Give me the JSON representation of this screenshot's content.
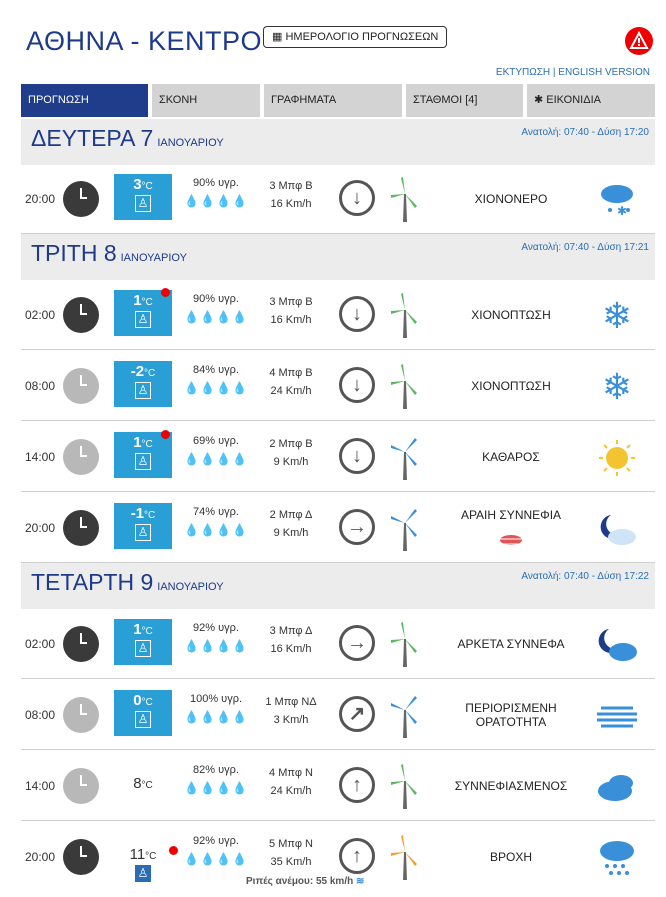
{
  "header": {
    "city": "ΑΘΗΝΑ - ΚΕΝΤΡΟ",
    "calendar_button": "ΗΜΕΡΟΛΟΓΙΟ ΠΡΟΓΝΩΣΕΩΝ",
    "print_link": "ΕΚΤΥΠΩΣΗ",
    "english_link": "ENGLISH VERSION"
  },
  "tabs": [
    {
      "label": "ΠΡΟΓΝΩΣΗ"
    },
    {
      "label": "ΣΚΟΝΗ"
    },
    {
      "label": "ΓΡΑΦΗΜΑΤΑ"
    },
    {
      "label": "ΣΤΑΘΜΟΙ [4]"
    },
    {
      "label": "ΕΙΚΟΝΙΔΙΑ"
    }
  ],
  "days": [
    {
      "name": "ΔΕΥΤΕΡΑ 7",
      "month": "ΙΑΝΟΥΑΡΙΟΥ",
      "sun": "Ανατολή: 07:40 - Δύση 17:20"
    },
    {
      "name": "ΤΡΙΤΗ 8",
      "month": "ΙΑΝΟΥΑΡΙΟΥ",
      "sun": "Ανατολή: 07:40 - Δύση 17:21"
    },
    {
      "name": "ΤΕΤΑΡΤΗ 9",
      "month": "ΙΑΝΟΥΑΡΙΟΥ",
      "sun": "Ανατολή: 07:40 - Δύση 17:22"
    }
  ],
  "rows": [
    {
      "time": "20:00",
      "temp": "3",
      "hum": "90% υγρ.",
      "wind1": "3 Μπφ Β",
      "wind2": "16 Km/h",
      "cond": "ΧΙΟΝΟΝΕΡΟ"
    },
    {
      "time": "02:00",
      "temp": "1",
      "hum": "90% υγρ.",
      "wind1": "3 Μπφ Β",
      "wind2": "16 Km/h",
      "cond": "ΧΙΟΝΟΠΤΩΣΗ"
    },
    {
      "time": "08:00",
      "temp": "-2",
      "hum": "84% υγρ.",
      "wind1": "4 Μπφ Β",
      "wind2": "24 Km/h",
      "cond": "ΧΙΟΝΟΠΤΩΣΗ"
    },
    {
      "time": "14:00",
      "temp": "1",
      "hum": "69% υγρ.",
      "wind1": "2 Μπφ Β",
      "wind2": "9 Km/h",
      "cond": "ΚΑΘΑΡΟΣ"
    },
    {
      "time": "20:00",
      "temp": "-1",
      "hum": "74% υγρ.",
      "wind1": "2 Μπφ Δ",
      "wind2": "9 Km/h",
      "cond": "ΑΡΑΙΗ ΣΥΝΝΕΦΙΑ"
    },
    {
      "time": "02:00",
      "temp": "1",
      "hum": "92% υγρ.",
      "wind1": "3 Μπφ Δ",
      "wind2": "16 Km/h",
      "cond": "ΑΡΚΕΤΑ ΣΥΝΝΕΦΑ"
    },
    {
      "time": "08:00",
      "temp": "0",
      "hum": "100% υγρ.",
      "wind1": "1 Μπφ ΝΔ",
      "wind2": "3 Km/h",
      "cond": "ΠΕΡΙΟΡΙΣΜΕΝΗ ΟΡΑΤΟΤΗΤΑ"
    },
    {
      "time": "14:00",
      "temp": "8",
      "hum": "82% υγρ.",
      "wind1": "4 Μπφ Ν",
      "wind2": "24 Km/h",
      "cond": "ΣΥΝΝΕΦΙΑΣΜΕΝΟΣ"
    },
    {
      "time": "20:00",
      "temp": "11",
      "hum": "92% υγρ.",
      "wind1": "5 Μπφ Ν",
      "wind2": "35 Km/h",
      "cond": "ΒΡΟΧΗ"
    }
  ],
  "units": {
    "celsius": "°C"
  },
  "gust": "Ριπές ανέμου: 55 km/h",
  "colors": {
    "accent": "#1f3d8a",
    "temp_box": "#2a9fd6",
    "alert": "#ee0000"
  }
}
